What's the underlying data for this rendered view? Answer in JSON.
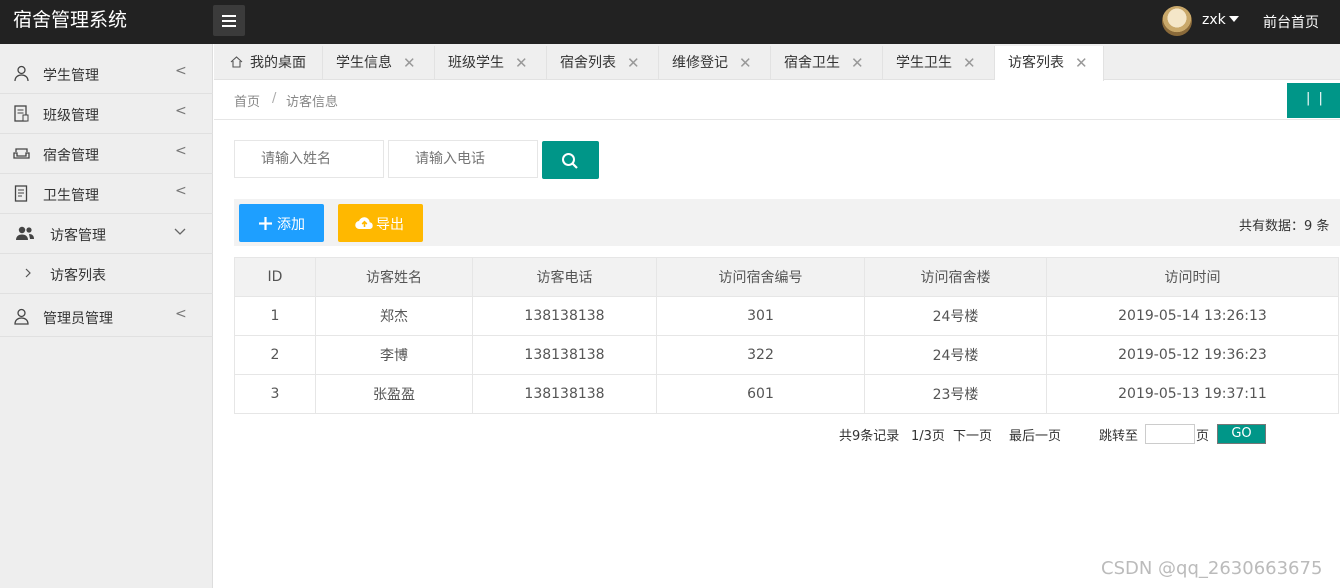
{
  "header": {
    "app_title": "宿舍管理系统",
    "username": "zxk",
    "frontpage_link": "前台首页"
  },
  "sidebar": {
    "items": [
      {
        "label": "学生管理",
        "icon": "user-icon",
        "arrow": "<"
      },
      {
        "label": "班级管理",
        "icon": "document-icon",
        "arrow": "<"
      },
      {
        "label": "宿舍管理",
        "icon": "sofa-icon",
        "arrow": "<"
      },
      {
        "label": "卫生管理",
        "icon": "notebook-icon",
        "arrow": "<"
      },
      {
        "label": "访客管理",
        "icon": "users-icon",
        "arrow": "v"
      },
      {
        "label": "访客列表",
        "icon": "chevron-right-icon"
      },
      {
        "label": "管理员管理",
        "icon": "user-admin-icon",
        "arrow": "<"
      }
    ]
  },
  "tabs": [
    {
      "label": "我的桌面"
    },
    {
      "label": "学生信息"
    },
    {
      "label": "班级学生"
    },
    {
      "label": "宿舍列表"
    },
    {
      "label": "维修登记"
    },
    {
      "label": "宿舍卫生"
    },
    {
      "label": "学生卫生"
    },
    {
      "label": "访客列表"
    }
  ],
  "tab_close": "✕",
  "breadcrumb": {
    "home": "首页",
    "sep": "/",
    "current": "访客信息"
  },
  "refresh_label": "| |",
  "search": {
    "name_placeholder": "请输入姓名",
    "phone_placeholder": "请输入电话"
  },
  "toolbar": {
    "add_label": "添加",
    "export_label": "导出",
    "total_text": "共有数据：9 条"
  },
  "table": {
    "headers": [
      "ID",
      "访客姓名",
      "访客电话",
      "访问宿舍编号",
      "访问宿舍楼",
      "访问时间"
    ],
    "rows": [
      [
        "1",
        "郑杰",
        "138138138",
        "301",
        "24号楼",
        "2019-05-14 13:26:13"
      ],
      [
        "2",
        "李博",
        "138138138",
        "322",
        "24号楼",
        "2019-05-12 19:36:23"
      ],
      [
        "3",
        "张盈盈",
        "138138138",
        "601",
        "23号楼",
        "2019-05-13 19:37:11"
      ]
    ]
  },
  "pager": {
    "records": "共9条记录",
    "pages": "1/3页",
    "next": "下一页",
    "last": "最后一页",
    "jump_to": "跳转至",
    "page_unit": "页",
    "go": "GO"
  },
  "watermark": "CSDN @qq_2630663675",
  "colors": {
    "primary": "#009688",
    "blue": "#1e9fff",
    "orange": "#ffb800",
    "header_bg": "#222222"
  }
}
